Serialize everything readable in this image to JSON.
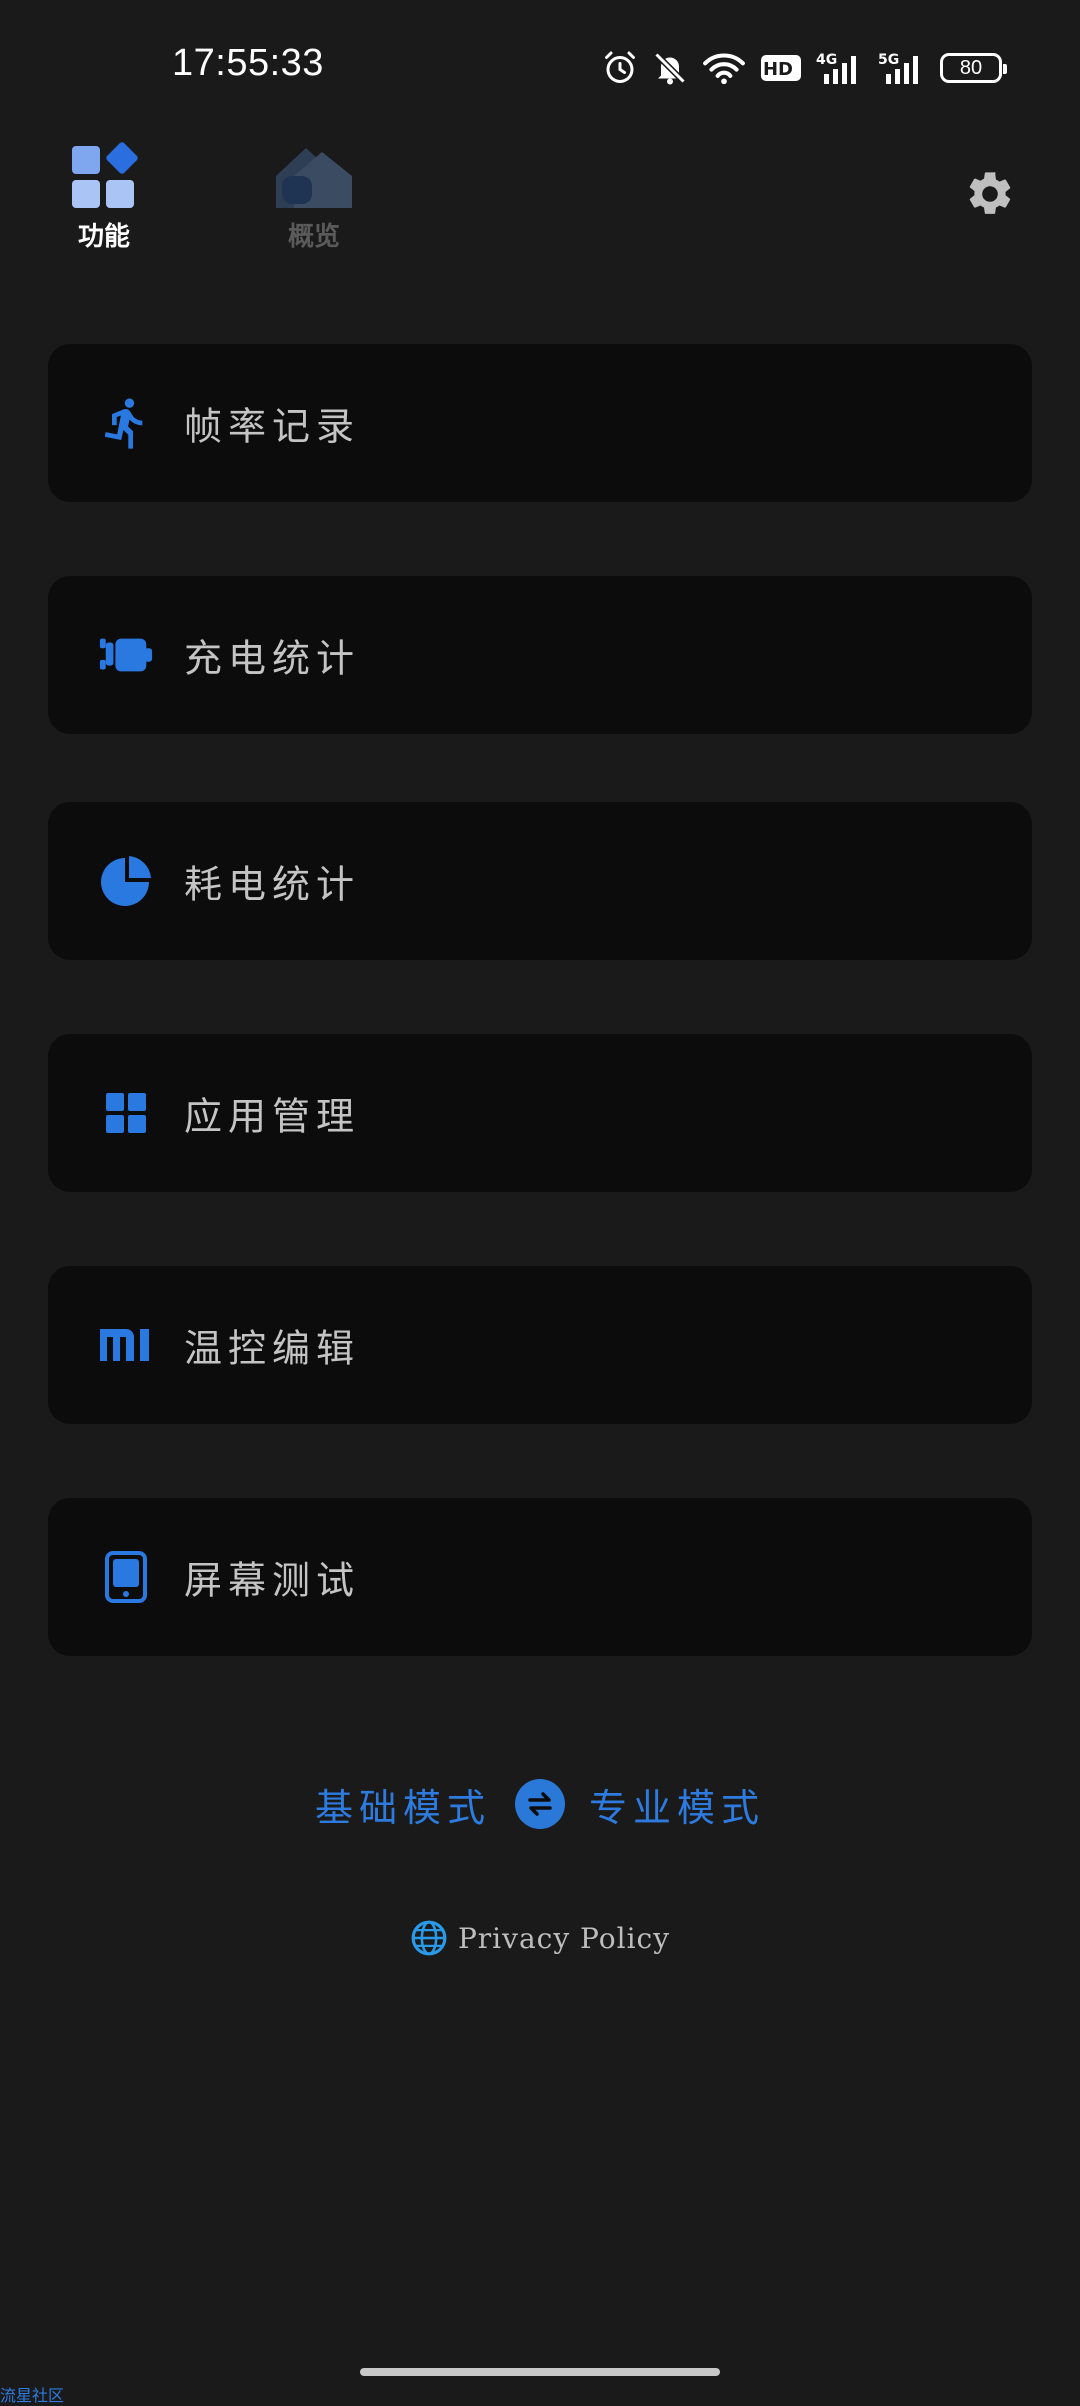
{
  "status_bar": {
    "time": "17:55:33",
    "battery": "80",
    "network_1": "4G",
    "network_2": "5G",
    "hd_badge": "HD"
  },
  "nav": {
    "tabs": [
      {
        "label": "功能",
        "icon": "features-grid-icon",
        "active": true
      },
      {
        "label": "概览",
        "icon": "overview-home-icon",
        "active": false
      }
    ],
    "settings_icon": "gear-icon"
  },
  "cards": [
    {
      "label": "帧率记录",
      "icon": "running-person-icon"
    },
    {
      "label": "充电统计",
      "icon": "charger-plug-icon"
    },
    {
      "label": "耗电统计",
      "icon": "pie-chart-icon"
    },
    {
      "label": "应用管理",
      "icon": "app-grid-icon"
    },
    {
      "label": "温控编辑",
      "icon": "mi-logo-icon"
    },
    {
      "label": "屏幕测试",
      "icon": "tablet-icon"
    }
  ],
  "mode_switch": {
    "basic_label": "基础模式",
    "pro_label": "专业模式"
  },
  "privacy": {
    "label": "Privacy Policy"
  },
  "watermark": "流星社区",
  "colors": {
    "background": "#1a1a1a",
    "card": "#0c0c0c",
    "accent": "#2e7be0"
  }
}
